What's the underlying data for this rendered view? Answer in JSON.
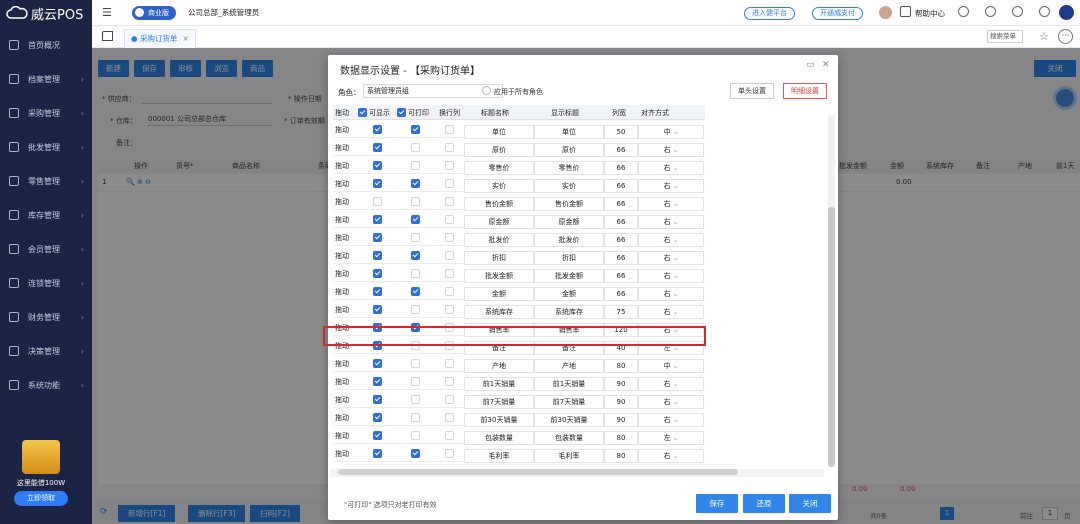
{
  "app": {
    "name": "威云POS"
  },
  "sidebar": {
    "items": [
      {
        "label": "首页概况",
        "icon": "home-icon"
      },
      {
        "label": "档案管理",
        "icon": "archive-icon"
      },
      {
        "label": "采购管理",
        "icon": "purchase-icon"
      },
      {
        "label": "批发管理",
        "icon": "wholesale-icon"
      },
      {
        "label": "零售管理",
        "icon": "retail-icon"
      },
      {
        "label": "库存管理",
        "icon": "inventory-icon"
      },
      {
        "label": "会员管理",
        "icon": "member-icon"
      },
      {
        "label": "连锁管理",
        "icon": "chain-icon"
      },
      {
        "label": "财务管理",
        "icon": "finance-icon"
      },
      {
        "label": "决策管理",
        "icon": "decision-icon"
      },
      {
        "label": "系统功能",
        "icon": "system-icon"
      }
    ],
    "promo": {
      "text": "这里能借100W",
      "button": "立即领取"
    }
  },
  "topbar": {
    "version_badge": "商业版",
    "company": "公司总部_系统管理员",
    "pill1": "进入健平台",
    "pill2": "开通威支付",
    "help": "帮助中心"
  },
  "tabbar": {
    "tab": "采购订货单",
    "menu_search": "搜索菜单"
  },
  "toolbar": {
    "buttons": [
      "新建",
      "保存",
      "审核",
      "浏览",
      "商品"
    ],
    "close": "关闭"
  },
  "form": {
    "supplier_label": "* 供应商：",
    "operator_label": "* 操作日期",
    "warehouse_label": "* 仓库：",
    "warehouse_value": "000001 公司总部总仓库",
    "valid_label": "* 订单有效期",
    "remark_label": "备注："
  },
  "grid": {
    "headers": [
      "操作",
      "货号*",
      "商品名称",
      "条码",
      "批发金额",
      "金额",
      "系统库存",
      "备注",
      "产地",
      "前1天"
    ],
    "row_num": "1",
    "amount": "0.00",
    "sum1": "0.00",
    "sum2": "0.00"
  },
  "bottom": {
    "buttons": [
      "新增行[F1]",
      "删除行[F3]",
      "扫码[F2]"
    ],
    "total": "共0条",
    "page": "1",
    "goto_label": "前往",
    "goto_value": "1",
    "page_suffix": "页"
  },
  "dialog": {
    "title": "数据显示设置 - 【采购订货单】",
    "role_label": "角色：",
    "role_value": "系统管理员组",
    "apply_all": "应用于所有角色",
    "btn_header": "单头设置",
    "btn_detail": "明细设置",
    "columns": [
      "拖动",
      "可显示",
      "可打印",
      "换行列",
      "标题名称",
      "显示标题",
      "列宽",
      "对齐方式"
    ],
    "rows": [
      {
        "drag": "拖动",
        "show": true,
        "print": true,
        "wrap": false,
        "name": "单位",
        "display": "单位",
        "width": "50",
        "align": "中"
      },
      {
        "drag": "拖动",
        "show": true,
        "print": false,
        "wrap": false,
        "name": "原价",
        "display": "原价",
        "width": "66",
        "align": "右"
      },
      {
        "drag": "拖动",
        "show": true,
        "print": false,
        "wrap": false,
        "name": "零售价",
        "display": "零售价",
        "width": "66",
        "align": "右"
      },
      {
        "drag": "拖动",
        "show": true,
        "print": true,
        "wrap": false,
        "name": "实价",
        "display": "实价",
        "width": "66",
        "align": "右"
      },
      {
        "drag": "拖动",
        "show": false,
        "print": false,
        "wrap": false,
        "name": "售价金额",
        "display": "售价金额",
        "width": "66",
        "align": "右"
      },
      {
        "drag": "拖动",
        "show": true,
        "print": true,
        "wrap": false,
        "name": "原金额",
        "display": "原金额",
        "width": "66",
        "align": "右"
      },
      {
        "drag": "拖动",
        "show": true,
        "print": false,
        "wrap": false,
        "name": "批发价",
        "display": "批发价",
        "width": "66",
        "align": "右"
      },
      {
        "drag": "拖动",
        "show": true,
        "print": true,
        "wrap": false,
        "name": "折扣",
        "display": "折扣",
        "width": "66",
        "align": "右"
      },
      {
        "drag": "拖动",
        "show": true,
        "print": false,
        "wrap": false,
        "name": "批发金额",
        "display": "批发金额",
        "width": "66",
        "align": "右"
      },
      {
        "drag": "拖动",
        "show": true,
        "print": true,
        "wrap": false,
        "name": "金额",
        "display": "金额",
        "width": "66",
        "align": "右"
      },
      {
        "drag": "拖动",
        "show": true,
        "print": false,
        "wrap": false,
        "name": "系统库存",
        "display": "系统库存",
        "width": "75",
        "align": "右"
      },
      {
        "drag": "拖动",
        "show": true,
        "print": true,
        "wrap": false,
        "name": "销售率",
        "display": "销售率",
        "width": "120",
        "align": "右"
      },
      {
        "drag": "拖动",
        "show": true,
        "print": false,
        "wrap": false,
        "name": "备注",
        "display": "备注",
        "width": "40",
        "align": "左"
      },
      {
        "drag": "拖动",
        "show": true,
        "print": false,
        "wrap": false,
        "name": "产地",
        "display": "产地",
        "width": "80",
        "align": "中"
      },
      {
        "drag": "拖动",
        "show": true,
        "print": false,
        "wrap": false,
        "name": "前1天销量",
        "display": "前1天销量",
        "width": "90",
        "align": "右"
      },
      {
        "drag": "拖动",
        "show": true,
        "print": false,
        "wrap": false,
        "name": "前7天销量",
        "display": "前7天销量",
        "width": "90",
        "align": "右"
      },
      {
        "drag": "拖动",
        "show": true,
        "print": false,
        "wrap": false,
        "name": "前30天销量",
        "display": "前30天销量",
        "width": "90",
        "align": "右"
      },
      {
        "drag": "拖动",
        "show": true,
        "print": false,
        "wrap": false,
        "name": "包装数量",
        "display": "包装数量",
        "width": "80",
        "align": "左"
      },
      {
        "drag": "拖动",
        "show": true,
        "print": true,
        "wrap": false,
        "name": "毛利率",
        "display": "毛利率",
        "width": "80",
        "align": "右"
      }
    ],
    "note": "\"可打印\" 选项只对老打印有效",
    "btn_save": "保存",
    "btn_restore": "还原",
    "btn_close": "关闭"
  }
}
